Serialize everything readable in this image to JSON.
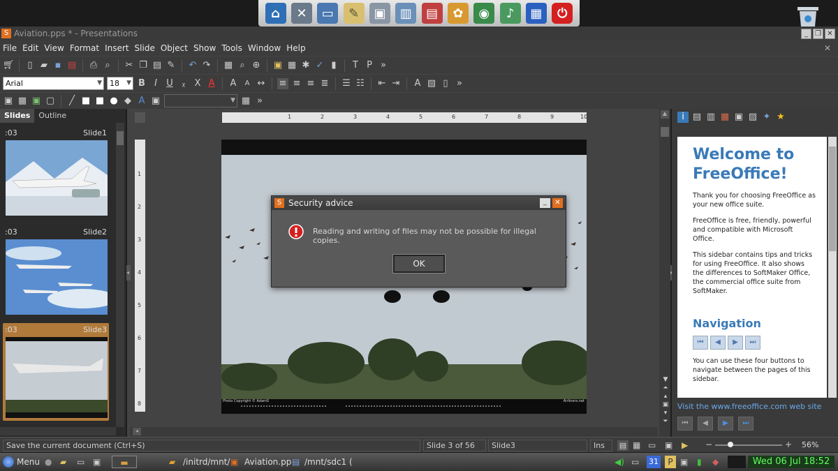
{
  "dock": {
    "icons": [
      "home-icon",
      "tools-icon",
      "monitor-icon",
      "notes-icon",
      "computer-icon",
      "library-icon",
      "office-icon",
      "paint-icon",
      "network-icon",
      "music-icon",
      "windows-icon",
      "power-icon"
    ],
    "colors": {
      "home": "#2f6fb5",
      "power": "#d42020"
    }
  },
  "window": {
    "title": "Aviation.pps * - Presentations"
  },
  "menu": [
    "File",
    "Edit",
    "View",
    "Format",
    "Insert",
    "Slide",
    "Object",
    "Show",
    "Tools",
    "Window",
    "Help"
  ],
  "format": {
    "font": "Arial",
    "size": "18",
    "bold": "B",
    "italic": "I",
    "underline": "U",
    "strike": "X",
    "color_a": "A"
  },
  "leftpanel": {
    "tabs": [
      "Slides",
      "Outline"
    ],
    "slides": [
      {
        "time": ":03",
        "label": "Slide1"
      },
      {
        "time": ":03",
        "label": "Slide2"
      },
      {
        "time": ":03",
        "label": "Slide3"
      }
    ]
  },
  "ruler": {
    "h": [
      "1",
      "2",
      "3",
      "4",
      "5",
      "6",
      "7",
      "8",
      "9",
      "10"
    ],
    "v": [
      "1",
      "2",
      "3",
      "4",
      "5",
      "6",
      "7",
      "8"
    ]
  },
  "slide": {
    "footer_left": "Photo Copyright © AdamS",
    "footer_right": "Airliners.net"
  },
  "dialog": {
    "title": "Security advice",
    "message": "Reading and writing of files may not be possible for illegal copies.",
    "ok": "OK"
  },
  "sidebar": {
    "heading": "Welcome to FreeOffice!",
    "p1": "Thank you for choosing FreeOffice as your new office suite.",
    "p2": "FreeOffice is free, friendly, powerful and compatible with Microsoft Office.",
    "p3": "This sidebar contains tips and tricks for using FreeOffice. It also shows the differences to SoftMaker Office, the commercial office suite from SoftMaker.",
    "nav_heading": "Navigation",
    "p4": "You can use these four buttons to navigate between the pages of this sidebar.",
    "link": "Visit the www.freeoffice.com web site"
  },
  "status": {
    "hint": "Save the current document (Ctrl+S)",
    "page": "Slide 3 of 56",
    "slide": "Slide3",
    "mode": "Ins",
    "zoom": "56%",
    "zoom_level": 0.56
  },
  "taskbar": {
    "menu": "Menu",
    "tasks": [
      "/initrd/mnt/",
      "Aviation.pp",
      "/mnt/sdc1 ("
    ],
    "calendar": "31",
    "clock": "Wed 06 Jul 18:52"
  }
}
